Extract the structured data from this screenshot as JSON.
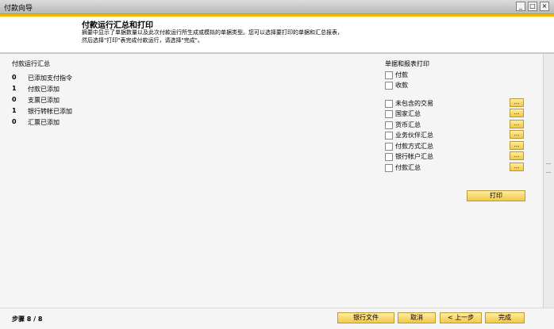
{
  "window": {
    "title": "付款向导",
    "minimize": "_",
    "maximize": "□",
    "close": "×"
  },
  "header": {
    "title": "付款运行汇总和打印",
    "description": "摘要中显示了单据数量以及此次付款运行所生成或模拟的单据类型。您可以选择要打印的单据和汇总报表，然后选择\"打印\"表完成付款运行，请选择\"完成\"。"
  },
  "summary": {
    "heading": "付款运行汇总",
    "rows": [
      {
        "count": "0",
        "label": "已添加支付指令"
      },
      {
        "count": "1",
        "label": "付款已添加"
      },
      {
        "count": "0",
        "label": "支票已添加"
      },
      {
        "count": "1",
        "label": "银行转帐已添加"
      },
      {
        "count": "0",
        "label": "汇票已添加"
      }
    ]
  },
  "print_docs": {
    "heading": "单据和报表打印",
    "docs": [
      {
        "label": "付款"
      },
      {
        "label": "收款"
      }
    ],
    "reports": [
      {
        "label": "未包含的交易",
        "button": "..."
      },
      {
        "label": "国家汇总",
        "button": "..."
      },
      {
        "label": "货币汇总",
        "button": "..."
      },
      {
        "label": "业务伙伴汇总",
        "button": "..."
      },
      {
        "label": "付款方式汇总",
        "button": "..."
      },
      {
        "label": "银行帐户汇总",
        "button": "..."
      },
      {
        "label": "付款汇总",
        "button": "..."
      }
    ],
    "print_button": "打印"
  },
  "footer": {
    "step": "步骤 8 / 8",
    "bank_file": "银行文件",
    "cancel": "取消",
    "back": "< 上一步",
    "finish": "完成"
  }
}
